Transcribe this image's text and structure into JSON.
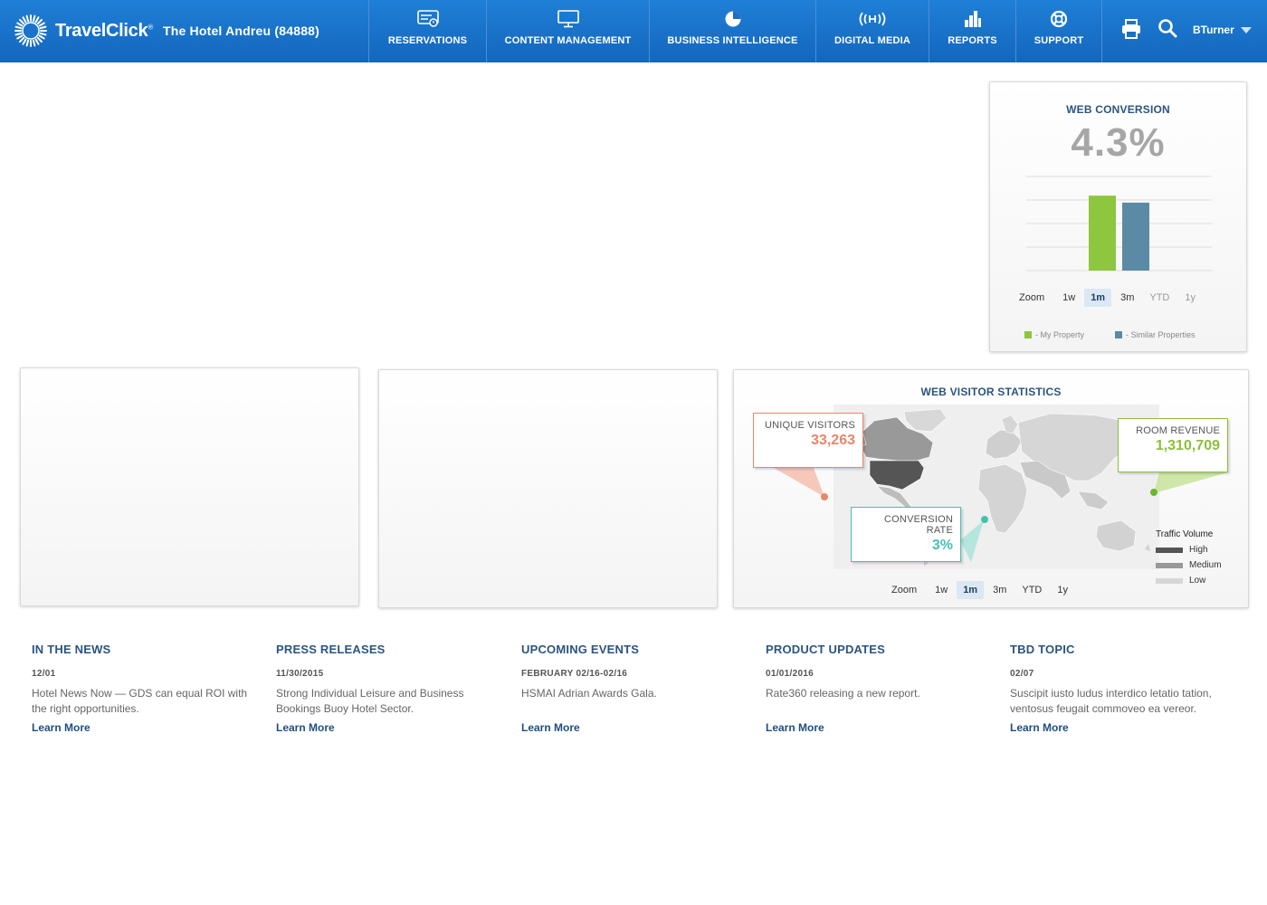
{
  "header": {
    "brand": "TravelClick",
    "brand_mark": "®",
    "hotel": "The Hotel Andreu (84888)",
    "nav": [
      {
        "label": "RESERVATIONS",
        "icon": "reservations-icon"
      },
      {
        "label": "CONTENT MANAGEMENT",
        "icon": "monitor-icon"
      },
      {
        "label": "BUSINESS INTELLIGENCE",
        "icon": "pie-chart-icon"
      },
      {
        "label": "DIGITAL MEDIA",
        "icon": "broadcast-icon"
      },
      {
        "label": "REPORTS",
        "icon": "bar-chart-icon"
      },
      {
        "label": "SUPPORT",
        "icon": "lifebuoy-icon"
      }
    ],
    "tools": [
      "print-icon",
      "search-icon"
    ],
    "user": "BTurner"
  },
  "web_conversion": {
    "title": "WEB CONVERSION",
    "value": "4.3%",
    "zoom_label": "Zoom",
    "zoom_options": [
      "1w",
      "1m",
      "3m",
      "YTD",
      "1y"
    ],
    "zoom_active": "1m",
    "legend": [
      {
        "label": "- My Property",
        "color": "#8dc63f"
      },
      {
        "label": "- Similar Properties",
        "color": "#5b8aa5"
      }
    ]
  },
  "chart_data": {
    "type": "bar",
    "categories": [
      "My Property",
      "Similar Properties"
    ],
    "values": [
      4.3,
      3.9
    ],
    "colors": [
      "#8dc63f",
      "#5b8aa5"
    ],
    "ylim": [
      0,
      5.4
    ],
    "grid": true,
    "title": "",
    "xlabel": "",
    "ylabel": ""
  },
  "web_visitor": {
    "title": "WEB VISITOR STATISTICS",
    "callouts": {
      "unique_visitors": {
        "label": "UNIQUE VISITORS",
        "value": "33,263",
        "color": "#e8866a"
      },
      "room_revenue": {
        "label": "ROOM REVENUE",
        "value": "1,310,709",
        "color": "#8dbf3b"
      },
      "conversion_rate": {
        "label": "CONVERSION RATE",
        "value": "3%",
        "color": "#46c1b0"
      }
    },
    "traffic": {
      "title": "Traffic Volume",
      "levels": [
        {
          "label": "High",
          "color": "#555555"
        },
        {
          "label": "Medium",
          "color": "#999999"
        },
        {
          "label": "Low",
          "color": "#d6d6d6"
        }
      ]
    },
    "zoom_label": "Zoom",
    "zoom_options": [
      "1w",
      "1m",
      "3m",
      "YTD",
      "1y"
    ],
    "zoom_active": "1m"
  },
  "news": [
    {
      "heading": "IN THE NEWS",
      "date": "12/01",
      "body": "Hotel News Now — GDS can equal ROI with the right opportunities.",
      "link": "Learn More"
    },
    {
      "heading": "PRESS RELEASES",
      "date": "11/30/2015",
      "body": "Strong Individual Leisure and Business Bookings Buoy Hotel Sector.",
      "link": "Learn More"
    },
    {
      "heading": "UPCOMING EVENTS",
      "date": "FEBRUARY 02/16-02/16",
      "body": "HSMAI Adrian Awards Gala.",
      "link": "Learn More"
    },
    {
      "heading": "PRODUCT UPDATES",
      "date": "01/01/2016",
      "body": "Rate360 releasing a new report.",
      "link": "Learn More"
    },
    {
      "heading": "TBD TOPIC",
      "date": "02/07",
      "body": "Suscipit iusto ludus interdico letatio tation, ventosus feugait commoveo ea vereor.",
      "link": "Learn More"
    }
  ]
}
